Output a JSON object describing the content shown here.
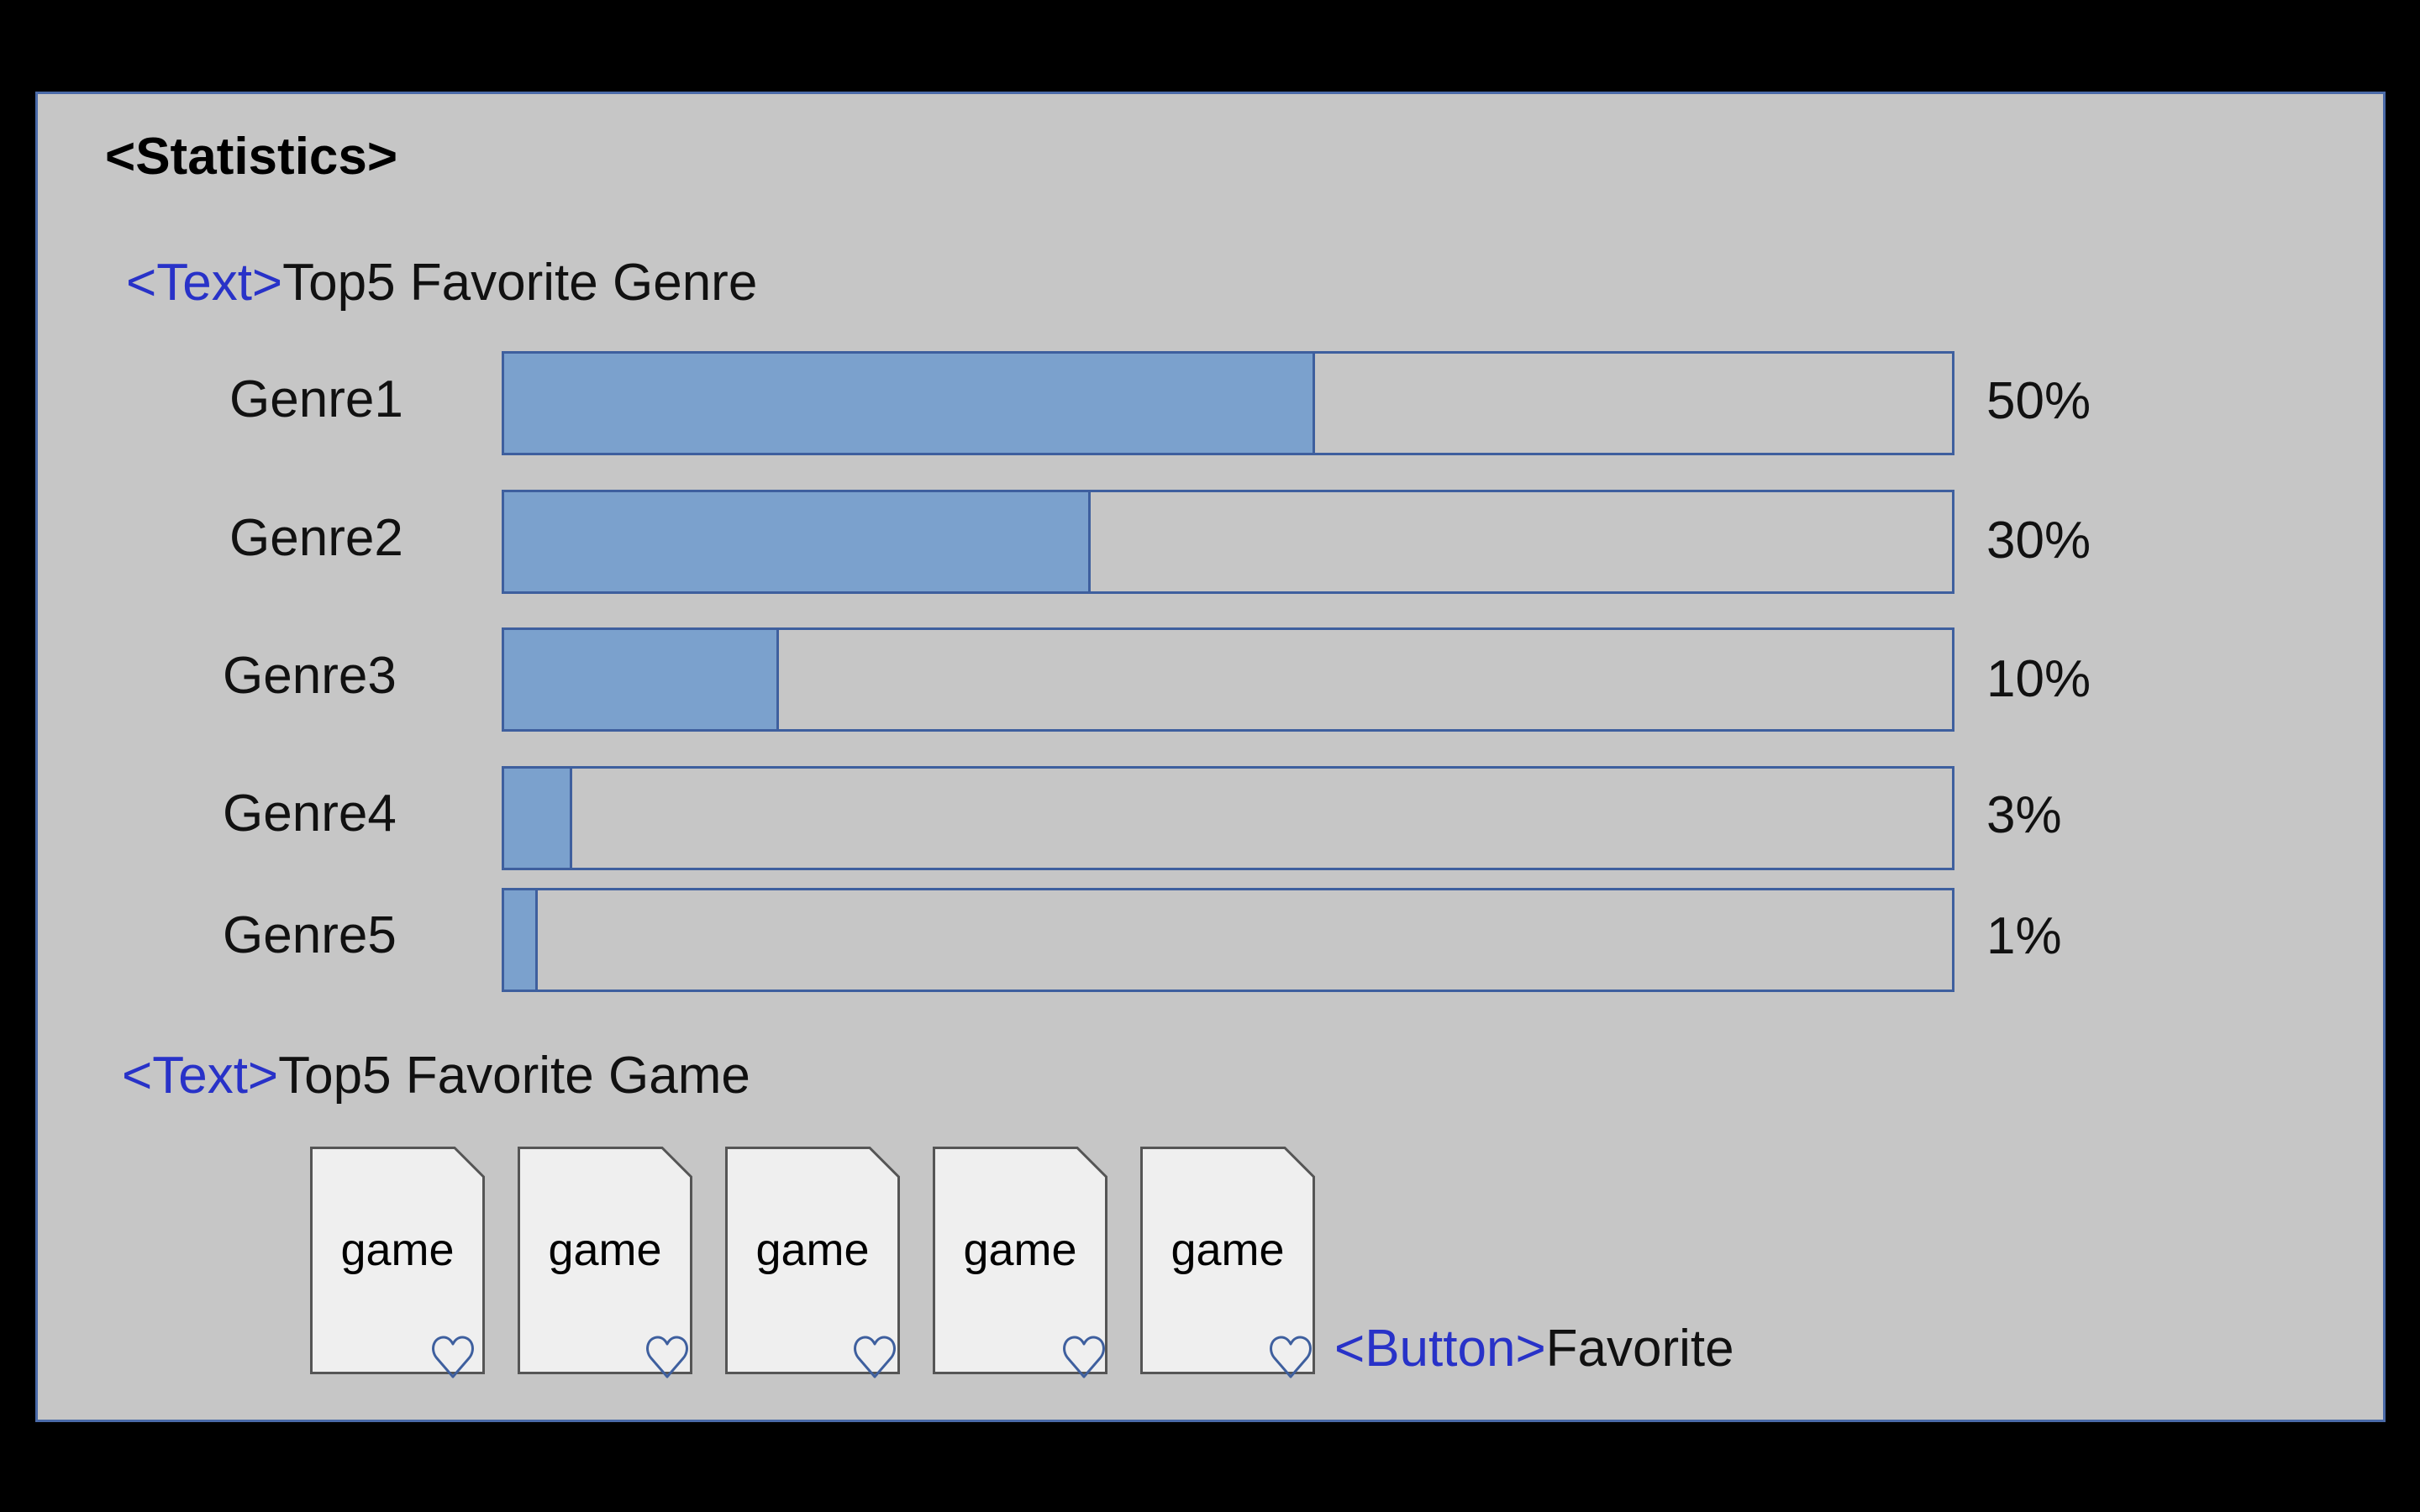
{
  "title": "<Statistics>",
  "genre_section": {
    "tag": "<Text>",
    "text": "Top5 Favorite Genre"
  },
  "genres": [
    {
      "label": "Genre1",
      "percent_text": "50%",
      "fill": 0.56
    },
    {
      "label": "Genre2",
      "percent_text": "30%",
      "fill": 0.405
    },
    {
      "label": "Genre3",
      "percent_text": "10%",
      "fill": 0.19
    },
    {
      "label": "Genre4",
      "percent_text": "3%",
      "fill": 0.047
    },
    {
      "label": "Genre5",
      "percent_text": "1%",
      "fill": 0.023
    }
  ],
  "game_section": {
    "tag": "<Text>",
    "text": "Top5 Favorite Game"
  },
  "games": [
    {
      "label": "game"
    },
    {
      "label": "game"
    },
    {
      "label": "game"
    },
    {
      "label": "game"
    },
    {
      "label": "game"
    }
  ],
  "favorite": {
    "tag": "<Button>",
    "text": "Favorite"
  },
  "colors": {
    "panel_bg": "#c6c6c6",
    "panel_border": "#4a6aa8",
    "bar_fill": "#7ba1cd",
    "bar_border": "#3e5f9e",
    "tag_text": "#2832c8",
    "card_bg": "#efefef"
  },
  "icons": {
    "favorite": "heart-icon"
  }
}
